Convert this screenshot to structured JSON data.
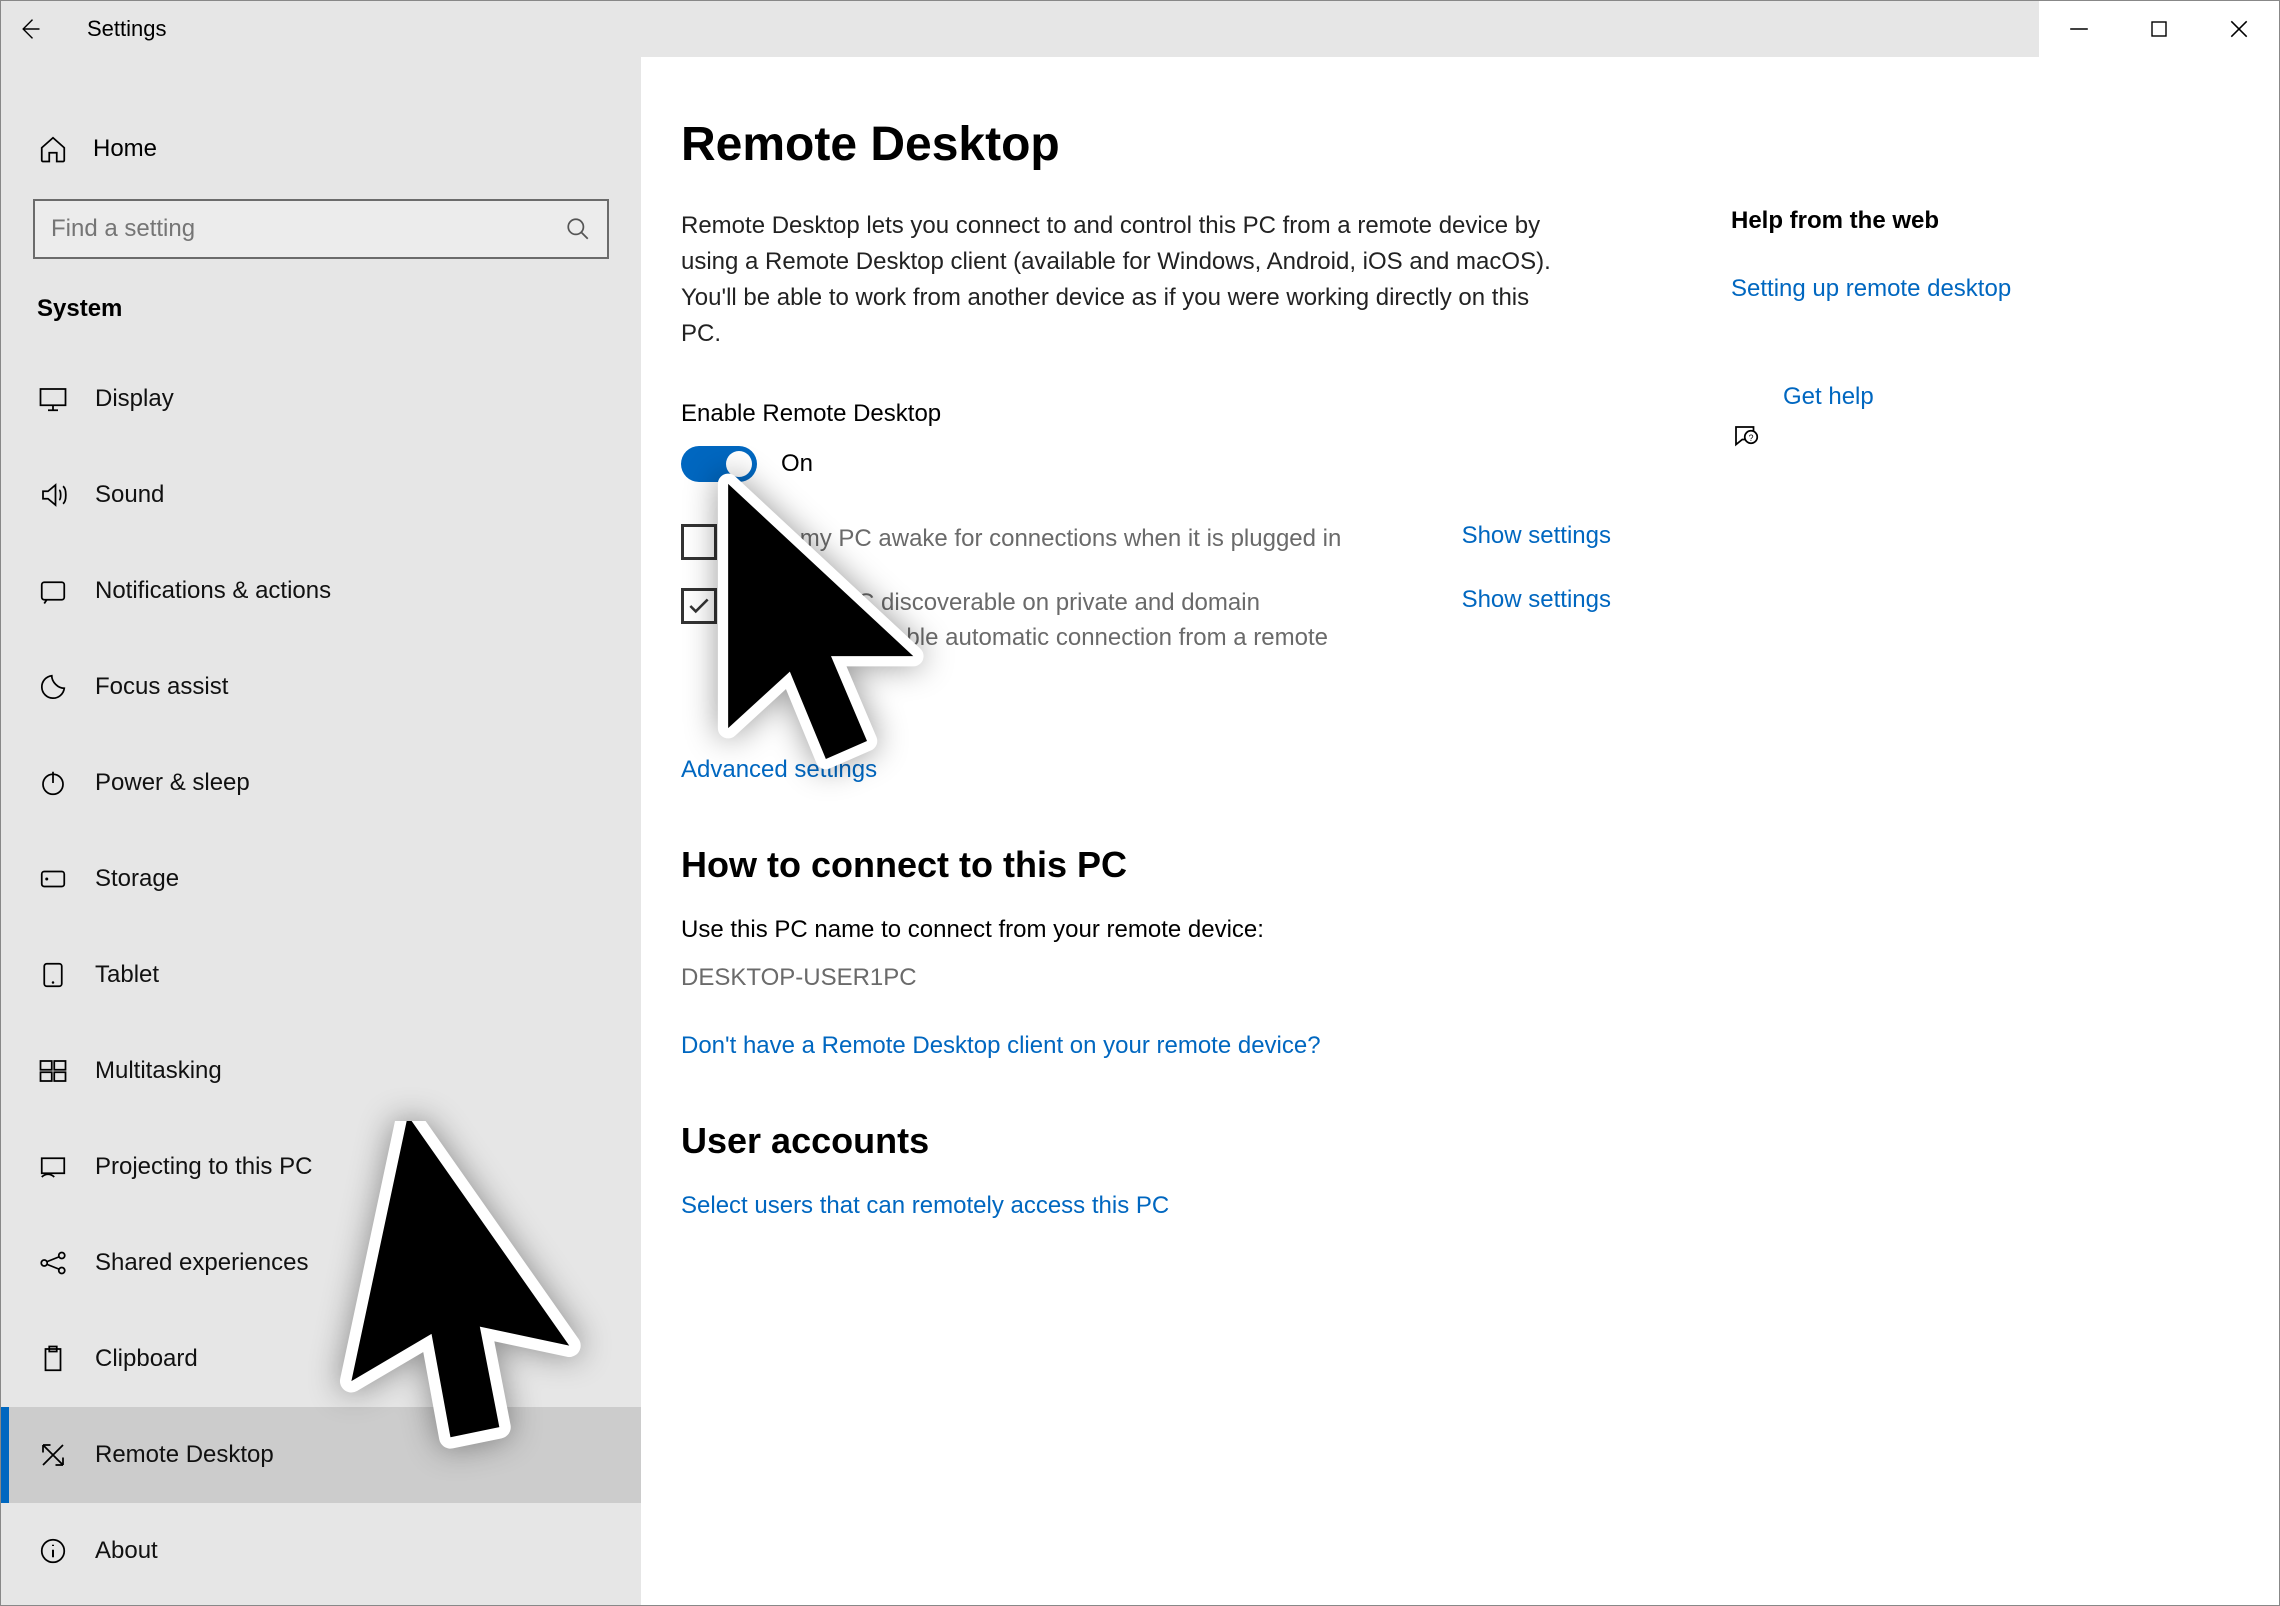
{
  "window": {
    "title": "Settings"
  },
  "sidebar": {
    "home": "Home",
    "search_placeholder": "Find a setting",
    "section": "System",
    "items": [
      {
        "label": "Display"
      },
      {
        "label": "Sound"
      },
      {
        "label": "Notifications & actions"
      },
      {
        "label": "Focus assist"
      },
      {
        "label": "Power & sleep"
      },
      {
        "label": "Storage"
      },
      {
        "label": "Tablet"
      },
      {
        "label": "Multitasking"
      },
      {
        "label": "Projecting to this PC"
      },
      {
        "label": "Shared experiences"
      },
      {
        "label": "Clipboard"
      },
      {
        "label": "Remote Desktop"
      },
      {
        "label": "About"
      }
    ]
  },
  "main": {
    "title": "Remote Desktop",
    "description": "Remote Desktop lets you connect to and control this PC from a remote device by using a Remote Desktop client (available for Windows, Android, iOS and macOS). You'll be able to work from another device as if you were working directly on this PC.",
    "enable_label": "Enable Remote Desktop",
    "toggle_state": "On",
    "option1": "Keep my PC awake for connections when it is plugged in",
    "option2": "Make my PC discoverable on private and domain networks to enable automatic connection from a remote device",
    "show_settings": "Show settings",
    "advanced": "Advanced settings",
    "connect_head": "How to connect to this PC",
    "connect_hint": "Use this PC name to connect from your remote device:",
    "pc_name": "DESKTOP-USER1PC",
    "client_link": "Don't have a Remote Desktop client on your remote device?",
    "user_accounts_head": "User accounts",
    "select_users": "Select users that can remotely access this PC"
  },
  "aside": {
    "help_head": "Help from the web",
    "setup_link": "Setting up remote desktop",
    "get_help": "Get help"
  }
}
